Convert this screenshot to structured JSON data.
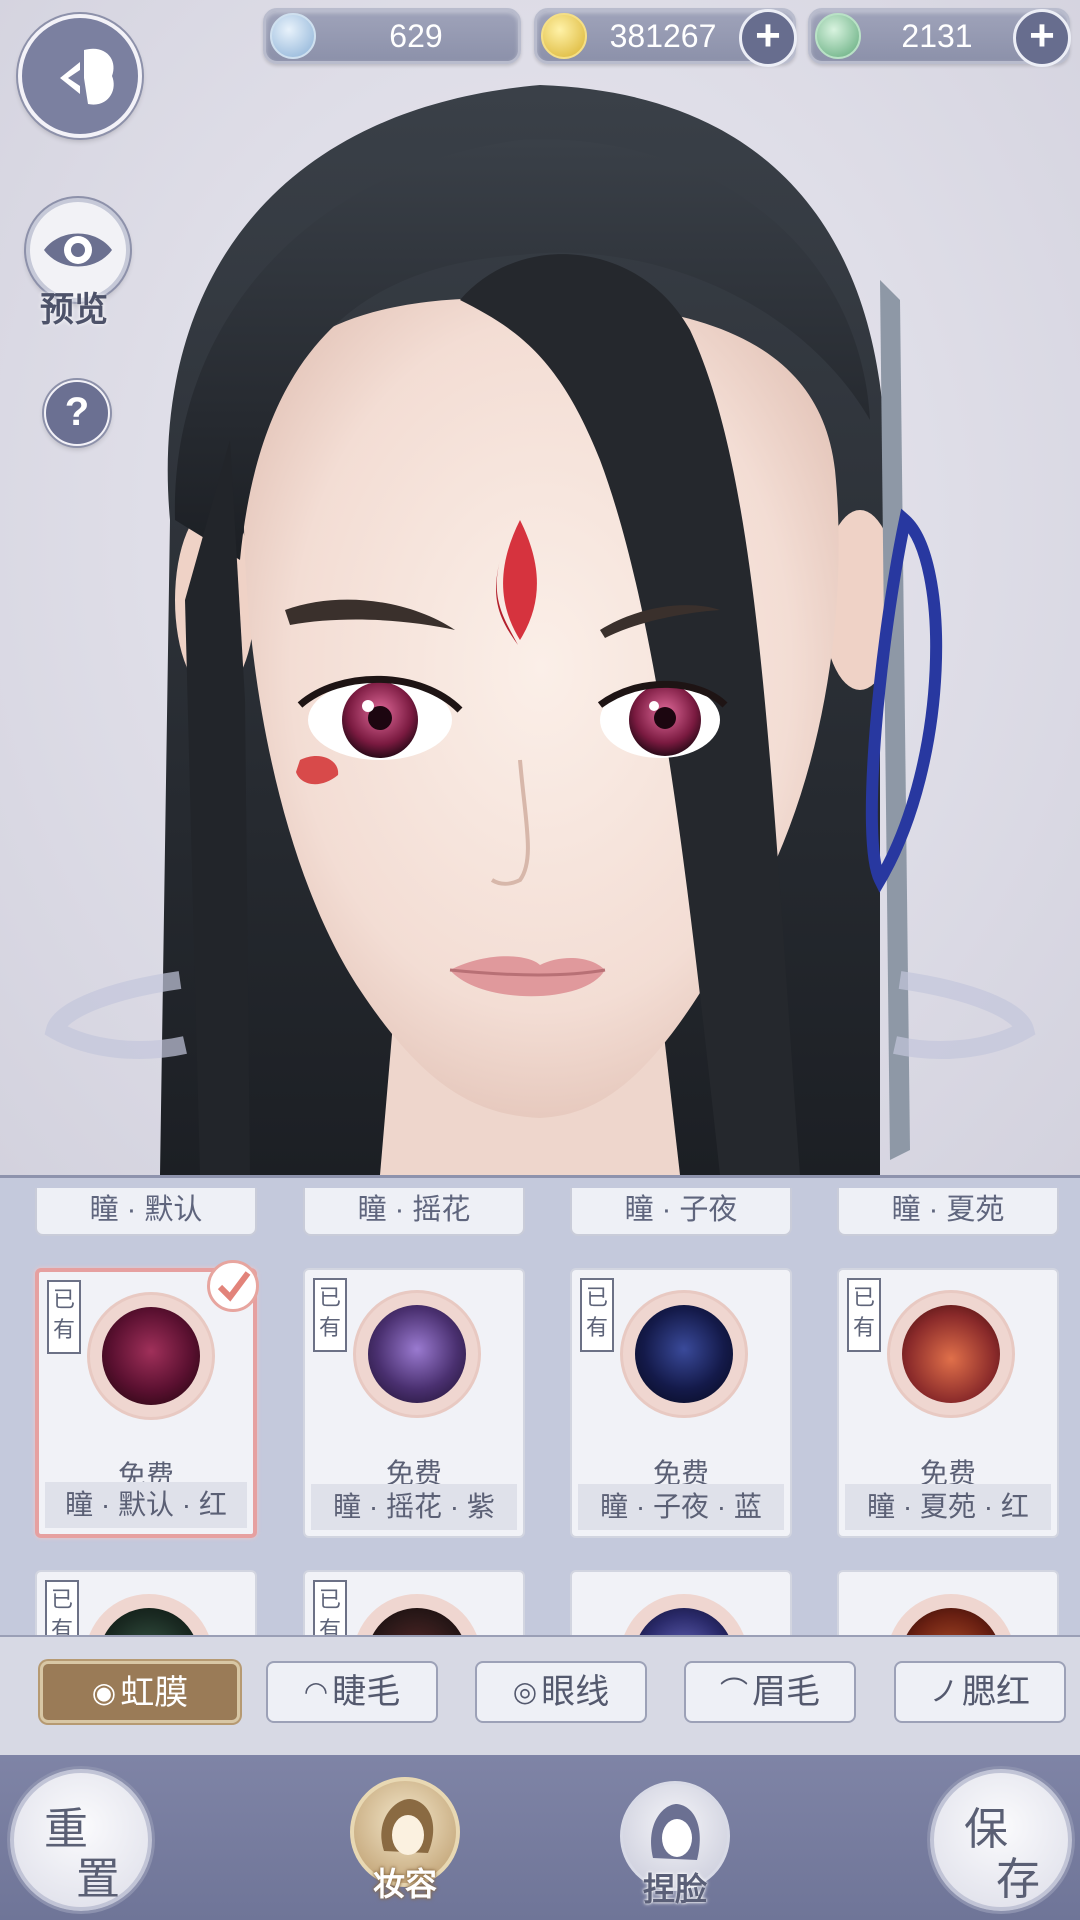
{
  "currencies": [
    {
      "id": "jade",
      "value": "629",
      "has_plus": false
    },
    {
      "id": "coin",
      "value": "381267",
      "has_plus": true
    },
    {
      "id": "spirit",
      "value": "2131",
      "has_plus": true
    }
  ],
  "left_controls": {
    "preview_label": "预览",
    "help_label": "?"
  },
  "categories": [
    "瞳 · 默认",
    "瞳 · 摇花",
    "瞳 · 子夜",
    "瞳 · 夏苑"
  ],
  "iris_items": [
    {
      "owned_label": "已有",
      "price": "免费",
      "name": "瞳 · 默认 · 红",
      "selected": true,
      "color": "#5a1030"
    },
    {
      "owned_label": "已有",
      "price": "免费",
      "name": "瞳 · 摇花 · 紫",
      "selected": false,
      "color": "#4a3070"
    },
    {
      "owned_label": "已有",
      "price": "免费",
      "name": "瞳 · 子夜 · 蓝",
      "selected": false,
      "color": "#141a4a"
    },
    {
      "owned_label": "已有",
      "price": "免费",
      "name": "瞳 · 夏苑 · 红",
      "selected": false,
      "color": "#8a2a2a"
    }
  ],
  "iris_row2": [
    {
      "owned_label": "已有",
      "color": "#1a2a22"
    },
    {
      "owned_label": "已有",
      "color": "#2a1818"
    },
    {
      "owned_label": "",
      "color": "#2a2a6a"
    },
    {
      "owned_label": "",
      "color": "#6a2012"
    }
  ],
  "tabs": [
    {
      "label": "虹膜",
      "icon": "iris-icon",
      "active": true
    },
    {
      "label": "睫毛",
      "icon": "eyelash-icon",
      "active": false
    },
    {
      "label": "眼线",
      "icon": "eyeliner-icon",
      "active": false
    },
    {
      "label": "眉毛",
      "icon": "eyebrow-icon",
      "active": false
    },
    {
      "label": "腮红",
      "icon": "blush-icon",
      "active": false
    }
  ],
  "bottom_nav": {
    "reset": {
      "l1": "重",
      "l2": "置"
    },
    "makeup": {
      "label": "妆容",
      "active": true
    },
    "face": {
      "label": "捏脸",
      "active": false
    },
    "save": {
      "l1": "保",
      "l2": "存"
    }
  }
}
